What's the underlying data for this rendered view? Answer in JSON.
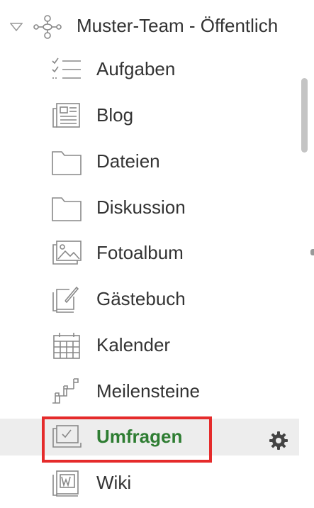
{
  "team": {
    "label": "Muster-Team - Öffentlich",
    "expanded": true,
    "icon": "team-network-icon"
  },
  "items": [
    {
      "label": "Aufgaben",
      "icon": "checklist-icon",
      "selected": false
    },
    {
      "label": "Blog",
      "icon": "newspaper-icon",
      "selected": false
    },
    {
      "label": "Dateien",
      "icon": "folder-icon",
      "selected": false
    },
    {
      "label": "Diskussion",
      "icon": "folder-icon",
      "selected": false
    },
    {
      "label": "Fotoalbum",
      "icon": "photo-album-icon",
      "selected": false
    },
    {
      "label": "Gästebuch",
      "icon": "guestbook-icon",
      "selected": false
    },
    {
      "label": "Kalender",
      "icon": "calendar-icon",
      "selected": false
    },
    {
      "label": "Meilensteine",
      "icon": "milestones-icon",
      "selected": false
    },
    {
      "label": "Umfragen",
      "icon": "poll-icon",
      "selected": true
    },
    {
      "label": "Wiki",
      "icon": "wiki-book-icon",
      "selected": false
    }
  ],
  "colors": {
    "selected_text": "#2e7d32",
    "selected_bg": "#ededed",
    "highlight_border": "#e52b2b",
    "icon_stroke": "#888888"
  },
  "selected_actions": {
    "icon": "gear-icon"
  }
}
